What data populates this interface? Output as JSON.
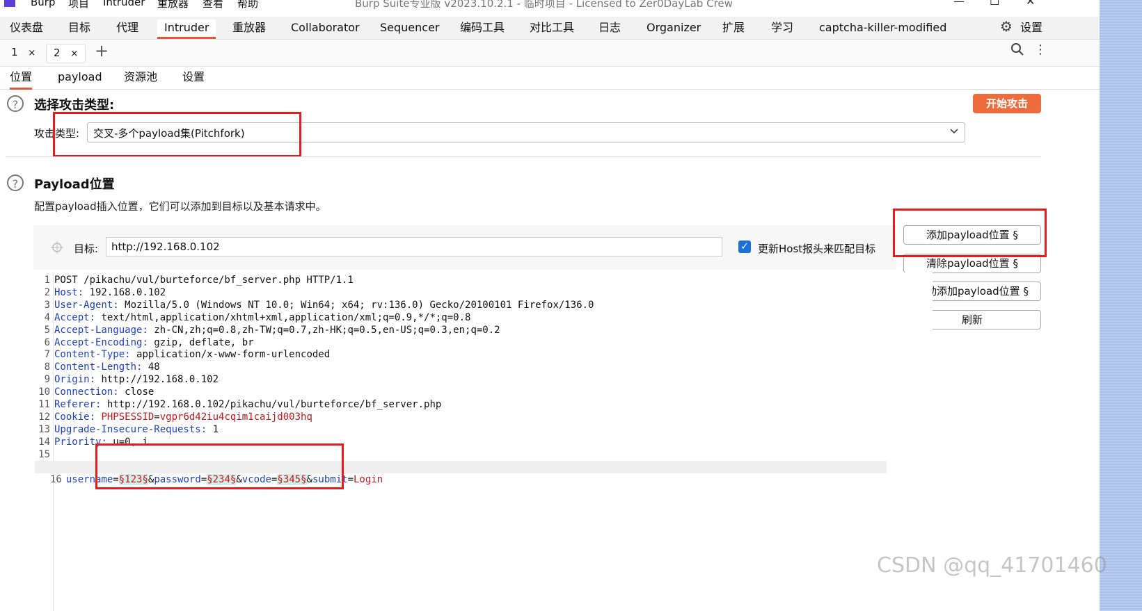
{
  "titlebar": {
    "menus": [
      "Burp",
      "项目",
      "Intruder",
      "重放器",
      "查看",
      "帮助"
    ],
    "app_title": "Burp Suite专业版  v2023.10.2.1 - 临时项目 - Licensed to Zer0DayLab Crew",
    "controls": {
      "minimize": "—",
      "maximize": "☐",
      "close": "✕"
    }
  },
  "main_tabs": [
    "仪表盘",
    "目标",
    "代理",
    "Intruder",
    "重放器",
    "Collaborator",
    "Sequencer",
    "编码工具",
    "对比工具",
    "日志",
    "Organizer",
    "扩展",
    "学习",
    "captcha-killer-modified"
  ],
  "active_main_tab": "Intruder",
  "settings_label": "设置",
  "sub_tabs": [
    {
      "label": "1",
      "close": "×"
    },
    {
      "label": "2",
      "close": "×"
    }
  ],
  "add_tab": "+",
  "inner_tabs": [
    "位置",
    "payload",
    "资源池",
    "设置"
  ],
  "attack_type_section": {
    "title": "选择攻击类型:",
    "field_label": "攻击类型:",
    "selected_value": "交叉-多个payload集(Pitchfork)",
    "start_button": "开始攻击"
  },
  "payload_section": {
    "title": "Payload位置",
    "description": "配置payload插入位置，它们可以添加到目标以及基本请求中。",
    "target_label": "目标:",
    "target_value": "http://192.168.0.102",
    "update_host_label": "更新Host报头来匹配目标",
    "update_host_checked": true
  },
  "side_buttons": [
    "添加payload位置 §",
    "清除payload位置 §",
    "自动添加payload位置 §",
    "刷新"
  ],
  "request_lines": [
    {
      "n": "1",
      "key": "",
      "value": "POST /pikachu/vul/burteforce/bf_server.php HTTP/1.1"
    },
    {
      "n": "2",
      "key": "Host",
      "value": "192.168.0.102"
    },
    {
      "n": "3",
      "key": "User-Agent",
      "value": "Mozilla/5.0 (Windows NT 10.0; Win64; x64; rv:136.0) Gecko/20100101 Firefox/136.0"
    },
    {
      "n": "4",
      "key": "Accept",
      "value": "text/html,application/xhtml+xml,application/xml;q=0.9,*/*;q=0.8"
    },
    {
      "n": "5",
      "key": "Accept-Language",
      "value": "zh-CN,zh;q=0.8,zh-TW;q=0.7,zh-HK;q=0.5,en-US;q=0.3,en;q=0.2"
    },
    {
      "n": "6",
      "key": "Accept-Encoding",
      "value": "gzip, deflate, br"
    },
    {
      "n": "7",
      "key": "Content-Type",
      "value": "application/x-www-form-urlencoded"
    },
    {
      "n": "8",
      "key": "Content-Length",
      "value": "48"
    },
    {
      "n": "9",
      "key": "Origin",
      "value": "http://192.168.0.102"
    },
    {
      "n": "10",
      "key": "Connection",
      "value": "close"
    },
    {
      "n": "11",
      "key": "Referer",
      "value": "http://192.168.0.102/pikachu/vul/burteforce/bf_server.php"
    },
    {
      "n": "12",
      "key": "Cookie",
      "value": ""
    },
    {
      "n": "13",
      "key": "Upgrade-Insecure-Requests",
      "value": "1"
    },
    {
      "n": "14",
      "key": "Priority",
      "value": "u=0, i"
    },
    {
      "n": "15",
      "key": "",
      "value": ""
    }
  ],
  "cookie": {
    "name": "PHPSESSID",
    "eq": "=",
    "value": "vgpr6d42iu4cqim1caijd003hq"
  },
  "body_line": {
    "n": "16",
    "p1": "username",
    "eq": "=",
    "v1": "§123§",
    "amp1": "&",
    "p2": "password",
    "v2": "§234§",
    "amp2": "&",
    "p3": "vcode",
    "v3": "§345§",
    "amp3": "&",
    "p4": "submit",
    "v4": "Login"
  },
  "watermark": "CSDN @qq_41701460"
}
